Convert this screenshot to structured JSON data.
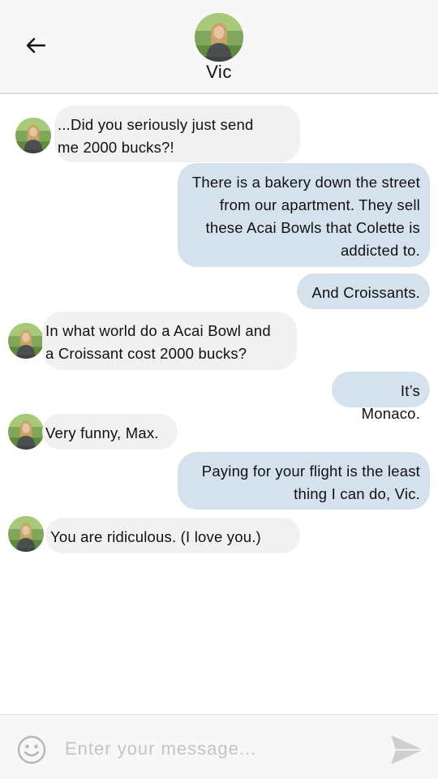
{
  "header": {
    "back_icon": "arrow-left-icon",
    "contact_name": "Vic",
    "avatar_icon": "contact-photo"
  },
  "messages": [
    {
      "from": "contact",
      "text": "...Did you seriously just send\nme 2000 bucks?!"
    },
    {
      "from": "me",
      "text": "There is a bakery down the street\nfrom our apartment. They sell\nthese Acai Bowls that Colette is\naddicted to."
    },
    {
      "from": "me",
      "text": "And Croissants."
    },
    {
      "from": "contact",
      "text": "In what world do a Acai Bowl and\na Croissant cost 2000 bucks?"
    },
    {
      "from": "me",
      "text": "It’s Monaco."
    },
    {
      "from": "contact",
      "text": "Very funny, Max."
    },
    {
      "from": "me",
      "text": "Paying for your flight is the least\nthing I can do, Vic."
    },
    {
      "from": "contact",
      "text": "You are ridiculous. (I love you.)"
    }
  ],
  "composer": {
    "placeholder": "Enter your message...",
    "emoji_icon": "smiley-icon",
    "send_icon": "send-icon"
  },
  "colors": {
    "incoming_bubble": "#f1f1f1",
    "outgoing_bubble": "#d5e2ed",
    "header_bg": "#f7f7f7"
  }
}
